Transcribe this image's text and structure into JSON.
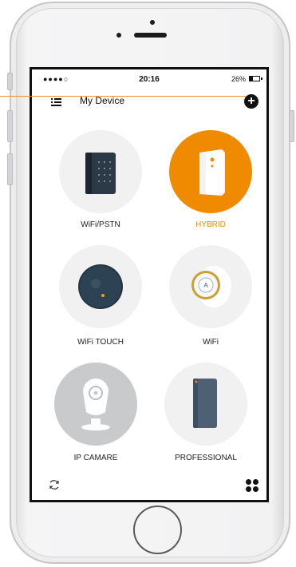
{
  "status_bar": {
    "carrier": "●●●●○",
    "time": "20:16",
    "battery": "26%"
  },
  "nav": {
    "title": "My Device"
  },
  "devices": [
    {
      "label": "WiFi/PSTN",
      "active": false
    },
    {
      "label": "HYBRID",
      "active": true
    },
    {
      "label": "WiFi TOUCH",
      "active": false
    },
    {
      "label": "WiFi",
      "active": false
    },
    {
      "label": "IP CAMARE",
      "active": false
    },
    {
      "label": "PROFESSIONAL",
      "active": false
    }
  ],
  "colors": {
    "accent": "#f08a00",
    "circle_bg": "#f1f1f1",
    "camera_circle": "#c9cacb",
    "device_dark": "#2d3e4d"
  },
  "icons": {
    "menu": "menu-icon",
    "add": "add-icon",
    "refresh": "refresh-icon",
    "grid": "grid-icon"
  }
}
